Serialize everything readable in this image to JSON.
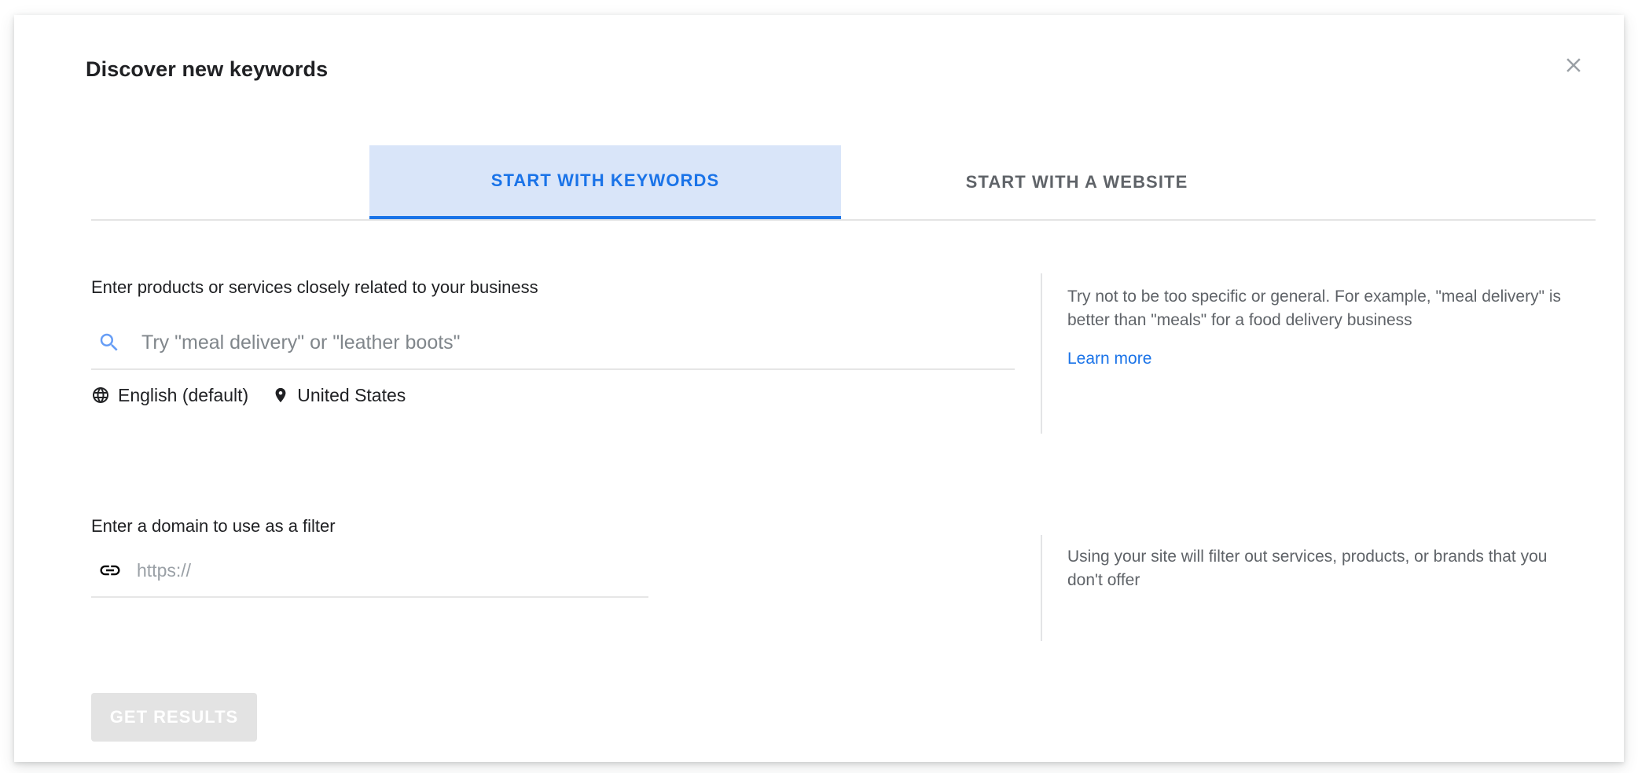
{
  "dialog": {
    "title": "Discover new keywords",
    "close_icon": "close-icon"
  },
  "tabs": [
    {
      "label": "START WITH KEYWORDS",
      "active": true
    },
    {
      "label": "START WITH A WEBSITE",
      "active": false
    }
  ],
  "keywords_section": {
    "label": "Enter products or services closely related to your business",
    "search_icon": "search-icon",
    "placeholder": "Try \"meal delivery\" or \"leather boots\"",
    "value": "",
    "locale": [
      {
        "icon": "globe-icon",
        "label": "English (default)"
      },
      {
        "icon": "location-pin-icon",
        "label": "United States"
      }
    ],
    "help": {
      "text": "Try not to be too specific or general. For example, \"meal delivery\" is better than \"meals\" for a food delivery business",
      "link": "Learn more"
    }
  },
  "domain_section": {
    "label": "Enter a domain to use as a filter",
    "link_icon": "link-icon",
    "placeholder": "https://",
    "value": "",
    "help": {
      "text": "Using your site will filter out services, products, or brands that you don't offer"
    }
  },
  "footer": {
    "submit_label": "GET RESULTS",
    "submit_disabled": true
  },
  "colors": {
    "accent": "#1a73e8",
    "tab_active_bg": "#d9e5f9",
    "text_primary": "#202124",
    "text_secondary": "#5f6368",
    "disabled_button_bg": "#e3e3e3"
  }
}
